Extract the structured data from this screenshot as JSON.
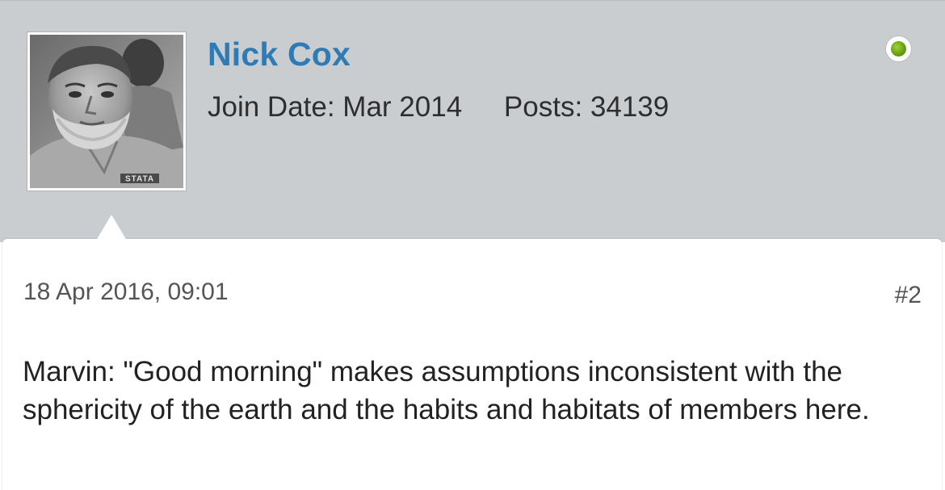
{
  "author": {
    "name": "Nick Cox",
    "join_date": "Join Date: Mar 2014",
    "posts": "Posts: 34139",
    "online_status_color": "#6aa014",
    "avatar_badge_text": "STATA"
  },
  "post": {
    "date": "18 Apr 2016, 09:01",
    "number": "#2",
    "body": "Marvin: \"Good morning\" makes assumptions inconsistent with the sphericity of the earth and the habits and habitats of members here."
  },
  "colors": {
    "author_name": "#2f7bb5",
    "header_background": "#c9cdd0"
  }
}
